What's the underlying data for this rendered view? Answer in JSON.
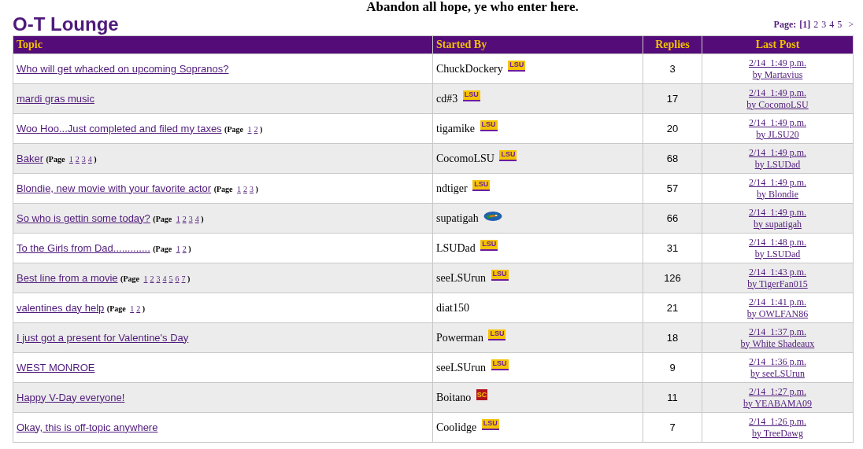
{
  "motto": "Abandon all hope, ye who enter here.",
  "board_title": "O-T Lounge",
  "pagination": {
    "label": "Page:",
    "pages": [
      {
        "label": "[1]",
        "selected": true
      },
      {
        "label": "2",
        "selected": false
      },
      {
        "label": "3",
        "selected": false
      },
      {
        "label": "4",
        "selected": false
      },
      {
        "label": "5",
        "selected": false
      }
    ],
    "next": ">"
  },
  "table": {
    "columns": [
      "Topic",
      "Started By",
      "Replies",
      "Last Post"
    ],
    "rows": [
      {
        "topic": {
          "title": "Who will get whacked on upcoming Sopranos?"
        },
        "author": "ChuckDockery",
        "logo": {
          "kind": "lsu",
          "text": "LSU"
        },
        "replies": "3",
        "last_time": "2/14  1:49 p.m.",
        "last_by": "by Martavius"
      },
      {
        "topic": {
          "title": "mardi gras music"
        },
        "author": "cd#3",
        "logo": {
          "kind": "lsu",
          "text": "LSU"
        },
        "replies": "17",
        "last_time": "2/14  1:49 p.m.",
        "last_by": "by CocomoLSU"
      },
      {
        "topic": {
          "title": "Woo Hoo...Just completed and filed my taxes",
          "pager": {
            "prefix": "(Page",
            "pages": [
              "1",
              "2"
            ],
            "suffix": ")"
          }
        },
        "author": "tigamike",
        "logo": {
          "kind": "lsu",
          "text": "LSU"
        },
        "replies": "20",
        "last_time": "2/14  1:49 p.m.",
        "last_by": "by JLSU20"
      },
      {
        "topic": {
          "title": "Baker",
          "pager": {
            "prefix": "(Page",
            "pages": [
              "1",
              "2",
              "3",
              "4"
            ],
            "suffix": ")"
          }
        },
        "author": "CocomoLSU",
        "logo": {
          "kind": "lsu",
          "text": "LSU"
        },
        "replies": "68",
        "last_time": "2/14  1:49 p.m.",
        "last_by": "by LSUDad"
      },
      {
        "topic": {
          "title": "Blondie, new movie with your favorite actor",
          "pager": {
            "prefix": "(Page",
            "pages": [
              "1",
              "2",
              "3"
            ],
            "suffix": ")"
          }
        },
        "author": "ndtiger",
        "logo": {
          "kind": "lsu",
          "text": "LSU"
        },
        "replies": "57",
        "last_time": "2/14  1:49 p.m.",
        "last_by": "by Blondie"
      },
      {
        "topic": {
          "title": "So who is gettin some today?",
          "pager": {
            "prefix": "(Page",
            "pages": [
              "1",
              "2",
              "3",
              "4"
            ],
            "suffix": ")"
          }
        },
        "author": "supatigah",
        "logo": {
          "kind": "gator"
        },
        "replies": "66",
        "last_time": "2/14  1:49 p.m.",
        "last_by": "by supatigah"
      },
      {
        "topic": {
          "title": "To the Girls from Dad.............",
          "pager": {
            "prefix": "(Page",
            "pages": [
              "1",
              "2"
            ],
            "suffix": ")"
          }
        },
        "author": "LSUDad",
        "logo": {
          "kind": "lsu",
          "text": "LSU"
        },
        "replies": "31",
        "last_time": "2/14  1:48 p.m.",
        "last_by": "by LSUDad"
      },
      {
        "topic": {
          "title": "Best line from a movie",
          "pager": {
            "prefix": "(Page",
            "pages": [
              "1",
              "2",
              "3",
              "4",
              "5",
              "6",
              "7"
            ],
            "suffix": ")"
          }
        },
        "author": "seeLSUrun",
        "logo": {
          "kind": "lsu",
          "text": "LSU"
        },
        "replies": "126",
        "last_time": "2/14  1:43 p.m.",
        "last_by": "by TigerFan015"
      },
      {
        "topic": {
          "title": "valentines day help",
          "pager": {
            "prefix": "(Page",
            "pages": [
              "1",
              "2"
            ],
            "suffix": ")"
          }
        },
        "author": "diat150",
        "replies": "21",
        "last_time": "2/14  1:41 p.m.",
        "last_by": "by OWLFAN86"
      },
      {
        "topic": {
          "title": "I just got a present for Valentine's Day"
        },
        "author": "Powerman",
        "logo": {
          "kind": "lsu",
          "text": "LSU"
        },
        "replies": "18",
        "last_time": "2/14  1:37 p.m.",
        "last_by": "by White Shadeaux"
      },
      {
        "topic": {
          "title": "WEST MONROE"
        },
        "author": "seeLSUrun",
        "logo": {
          "kind": "lsu",
          "text": "LSU"
        },
        "replies": "9",
        "last_time": "2/14  1:36 p.m.",
        "last_by": "by seeLSUrun"
      },
      {
        "topic": {
          "title": "Happy V-Day everyone!"
        },
        "author": "Boitano",
        "logo": {
          "kind": "sc",
          "text": "SC"
        },
        "replies": "11",
        "last_time": "2/14  1:27 p.m.",
        "last_by": "by YEABAMA09"
      },
      {
        "topic": {
          "title": "Okay, this is off-topic anywhere"
        },
        "author": "Coolidge",
        "logo": {
          "kind": "lsu",
          "text": "LSU"
        },
        "replies": "7",
        "last_time": "2/14  1:26 p.m.",
        "last_by": "by TreeDawg"
      }
    ]
  }
}
